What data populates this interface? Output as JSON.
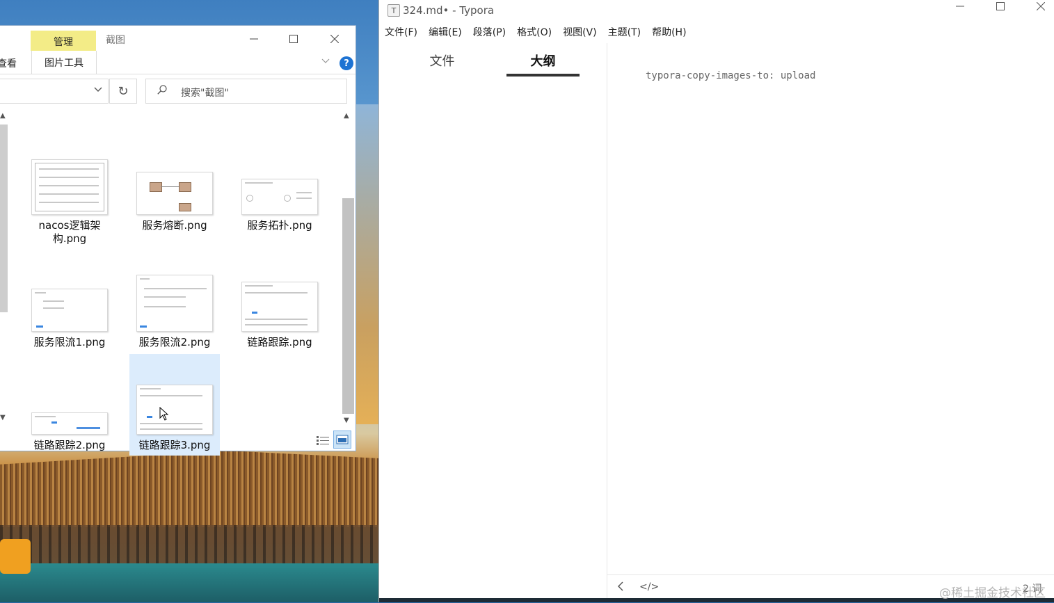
{
  "explorer": {
    "tab_manage": "管理",
    "title": "截图",
    "ribbon_view": "查看",
    "ribbon_picture_tools": "图片工具",
    "search_placeholder": "搜索\"截图\"",
    "files": [
      {
        "name": "nacos逻辑架构.png"
      },
      {
        "name": "服务熔断.png"
      },
      {
        "name": "服务拓扑.png"
      },
      {
        "name": "服务限流1.png"
      },
      {
        "name": "服务限流2.png"
      },
      {
        "name": "链路跟踪.png"
      },
      {
        "name": "链路跟踪2.png"
      },
      {
        "name": "链路跟踪3.png",
        "selected": true
      }
    ]
  },
  "typora": {
    "title": "324.md• - Typora",
    "app_icon_letter": "T",
    "menu": [
      "文件(F)",
      "编辑(E)",
      "段落(P)",
      "格式(O)",
      "视图(V)",
      "主题(T)",
      "帮助(H)"
    ],
    "sidebar_tabs": {
      "files": "文件",
      "outline": "大纲",
      "active": "outline"
    },
    "editor_line": "typora-copy-images-to: upload",
    "status_words": "2 词"
  },
  "watermark": "@稀土掘金技术社区",
  "colors": {
    "manage_tab": "#f3ec87",
    "selection": "#dcecfc",
    "help_icon": "#1d73d3"
  }
}
